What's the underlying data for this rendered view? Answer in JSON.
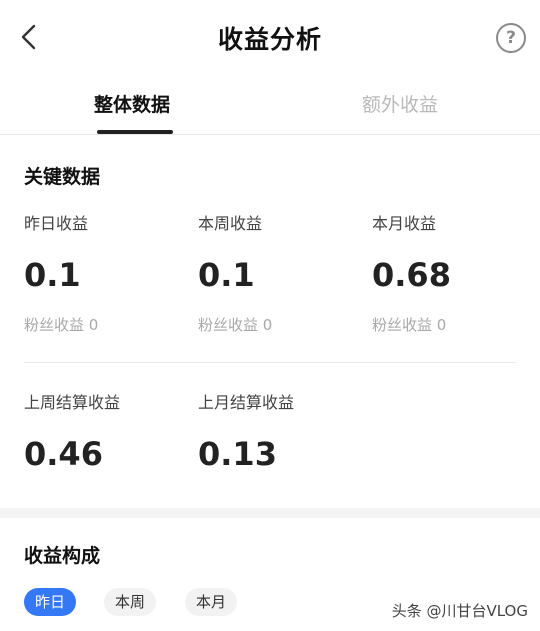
{
  "header": {
    "title": "收益分析",
    "help_glyph": "?"
  },
  "tabs": [
    {
      "label": "整体数据",
      "active": true
    },
    {
      "label": "额外收益",
      "active": false
    }
  ],
  "key_data": {
    "title": "关键数据",
    "metrics": [
      {
        "label": "昨日收益",
        "value": "0.1",
        "sub": "粉丝收益 0"
      },
      {
        "label": "本周收益",
        "value": "0.1",
        "sub": "粉丝收益 0"
      },
      {
        "label": "本月收益",
        "value": "0.68",
        "sub": "粉丝收益 0"
      },
      {
        "label": "上周结算收益",
        "value": "0.46"
      },
      {
        "label": "上月结算收益",
        "value": "0.13"
      }
    ]
  },
  "composition": {
    "title": "收益构成",
    "chips": [
      {
        "label": "昨日",
        "active": true
      },
      {
        "label": "本周",
        "active": false
      },
      {
        "label": "本月",
        "active": false
      }
    ]
  },
  "watermark": "头条 @川甘台VLOG",
  "colors": {
    "accent": "#3478f6"
  }
}
